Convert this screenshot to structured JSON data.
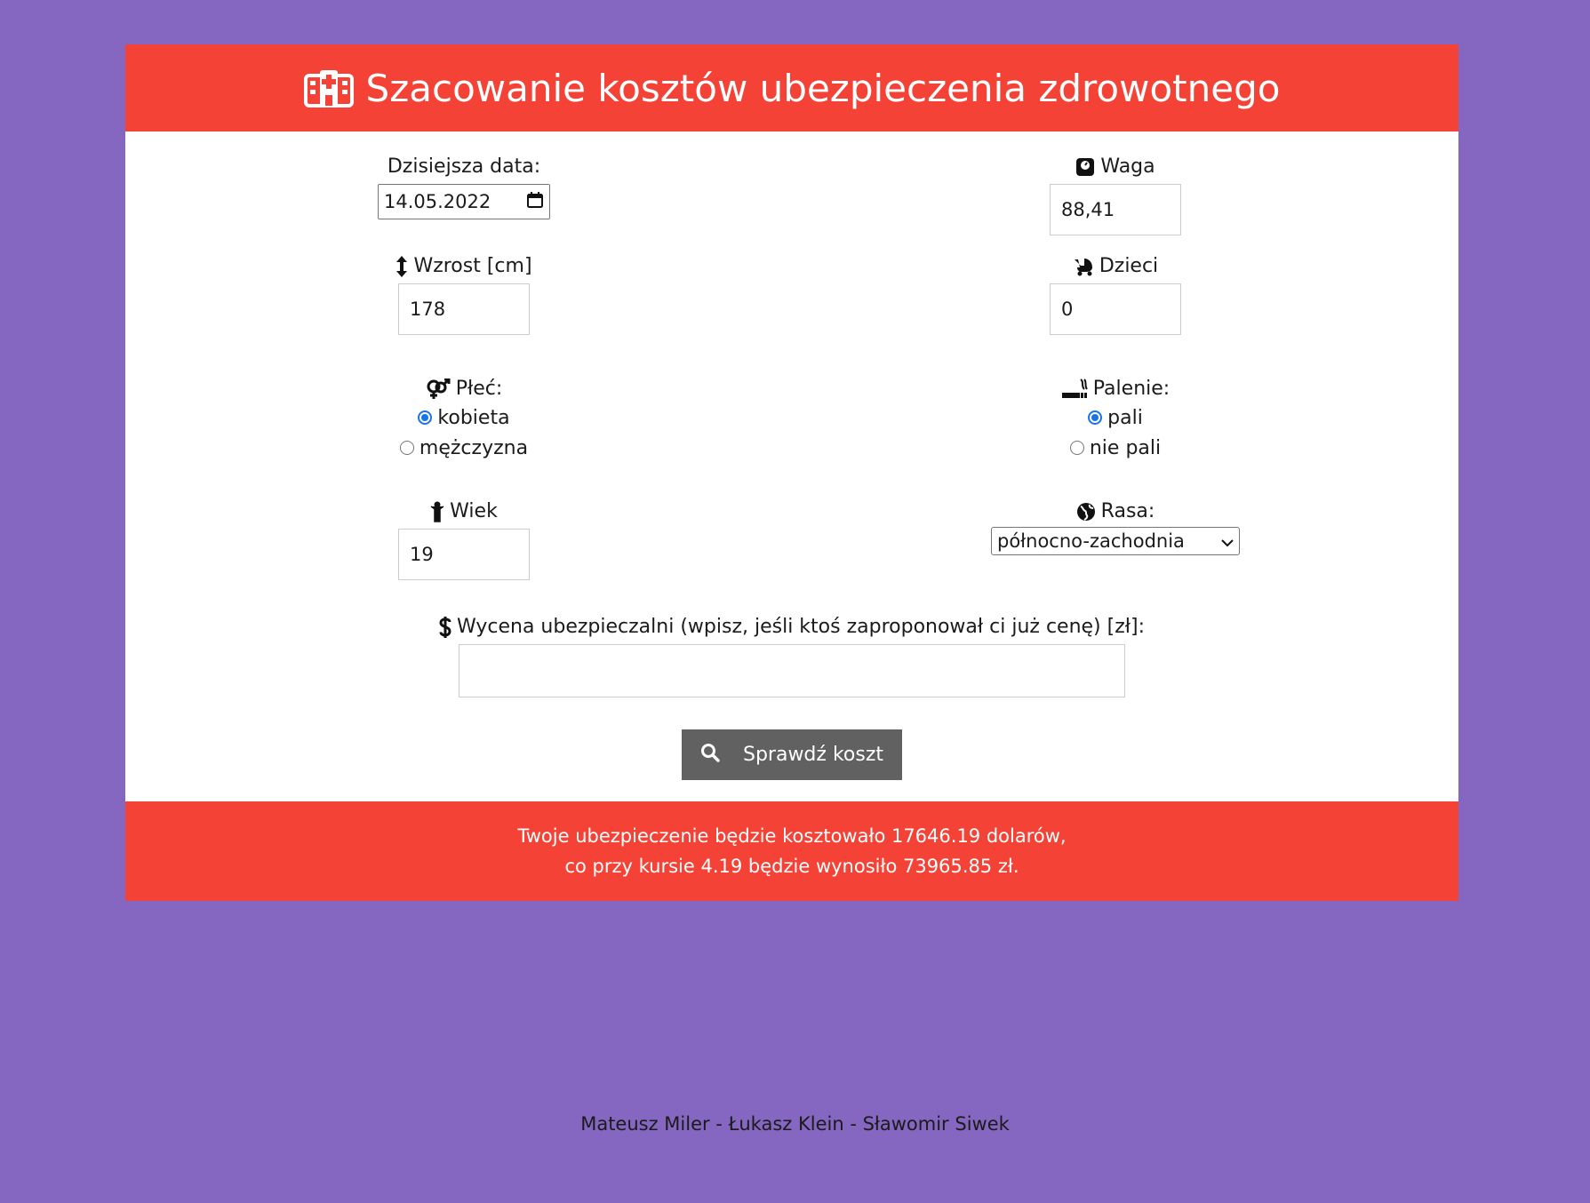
{
  "header": {
    "title": "Szacowanie kosztów ubezpieczenia zdrowotnego",
    "icon": "hospital-icon"
  },
  "form": {
    "date": {
      "label": "Dzisiejsza data:",
      "value": "14.05.2022",
      "icon": "calendar-icon"
    },
    "weight": {
      "label": "Waga",
      "value": "88,41",
      "icon": "scale-icon"
    },
    "height": {
      "label": "Wzrost [cm]",
      "value": "178",
      "icon": "arrows-vertical-icon"
    },
    "children": {
      "label": "Dzieci",
      "value": "0",
      "icon": "baby-carriage-icon"
    },
    "sex": {
      "label": "Płeć:",
      "icon": "venus-mars-icon",
      "options": [
        {
          "label": "kobieta",
          "checked": true
        },
        {
          "label": "mężczyzna",
          "checked": false
        }
      ]
    },
    "smoking": {
      "label": "Palenie:",
      "icon": "smoking-icon",
      "options": [
        {
          "label": "pali",
          "checked": true
        },
        {
          "label": "nie pali",
          "checked": false
        }
      ]
    },
    "age": {
      "label": "Wiek",
      "value": "19",
      "icon": "child-icon"
    },
    "region": {
      "label": "Rasa:",
      "value": "północno-zachodnia",
      "icon": "globe-icon"
    },
    "quote": {
      "label": "Wycena ubezpieczalni (wpisz, jeśli ktoś zaproponował ci już cenę) [zł]:",
      "value": "",
      "icon": "dollar-icon"
    },
    "submit": {
      "label": "Sprawdź koszt",
      "icon": "search-icon"
    }
  },
  "result": {
    "line1": "Twoje ubezpieczenie będzie kosztowało 17646.19 dolarów,",
    "line2": "co przy kursie 4.19 będzie wynosiło 73965.85 zł."
  },
  "footer": {
    "authors": "Mateusz Miler - Łukasz Klein - Sławomir Siwek"
  },
  "colors": {
    "background": "#8566c1",
    "accent": "#f44336",
    "button": "#616161",
    "radio": "#1a73e8"
  }
}
